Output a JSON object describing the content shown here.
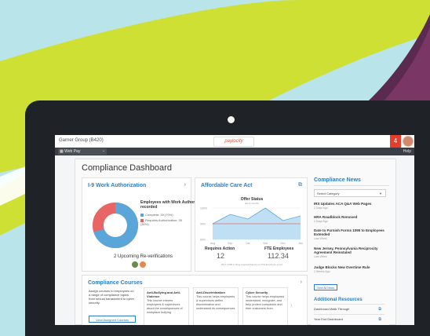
{
  "app": {
    "company": "Garner Group (B420)",
    "brand": "paylocity",
    "notification_count": "4",
    "product": "Web Pay",
    "help": "Help"
  },
  "page": {
    "title": "Compliance Dashboard"
  },
  "i9": {
    "title": "I-9 Work Authorization",
    "employees_title": "Employees with Work Authorization recorded",
    "legend_complete": "Complete: 30 (70%)",
    "legend_requires": "Requires Authorization: 30 (30%)",
    "complete_fraction": 0.7,
    "upcoming": "2 Upcoming Re-verifications"
  },
  "aca": {
    "title": "Affordable Care Act",
    "chart_title": "Offer Status",
    "chart_subtitle": "last 6 months",
    "requires_action_label": "Requires Action",
    "requires_action_value": "12",
    "fte_label": "FTE Employees",
    "fte_value": "112.34",
    "footnote": "2017 1095-C filing required based on FTE Employee count",
    "chart_data": {
      "type": "area",
      "x": [
        "Aug",
        "Sep",
        "Oct",
        "Nov",
        "Dec",
        "Jan"
      ],
      "y_ticks": [
        "100%",
        "90%",
        "80%"
      ],
      "values": [
        90,
        96,
        93,
        100,
        92,
        95
      ],
      "threshold": 90,
      "ylim": [
        80,
        100
      ]
    }
  },
  "news": {
    "title": "Compliance News",
    "select_placeholder": "Select Category",
    "items": [
      {
        "title": "IRS Updates ACA Q&A Web Pages",
        "date": "2 Days Ago"
      },
      {
        "title": "HRA Roadblock Removed",
        "date": "2 Days Ago"
      },
      {
        "title": "Date to Furnish Forms 1095 to Employees Extended",
        "date": "Last Week"
      },
      {
        "title": "New Jersey, Pennsylvania Reciprocity Agreement Reinstated",
        "date": "Last Week"
      },
      {
        "title": "Judge Blocks New Overtime Rule",
        "date": "2 Weeks Ago"
      }
    ],
    "view_all": "View All News"
  },
  "resources": {
    "title": "Additional Resources",
    "items": [
      "Dashboard Walk Through",
      "Year End Dashboard"
    ]
  },
  "courses": {
    "title": "Compliance Courses",
    "description": "Assign courses to employees on a range of compliance topics from sexual harassment to cyber security.",
    "button": "View Assigned Courses",
    "cards": [
      {
        "title": "Anti-Bullying and Anti-Violence",
        "desc": "This course informs employees & supervisors about the consequences of workplace bullying"
      },
      {
        "title": "Anti-Discrimination",
        "desc": "This course helps employees & supervisors define discrimination and understand its consequences"
      },
      {
        "title": "Cyber Security",
        "desc": "This course helps employees understand, recognize, and help protect companies and their customers from"
      }
    ]
  }
}
